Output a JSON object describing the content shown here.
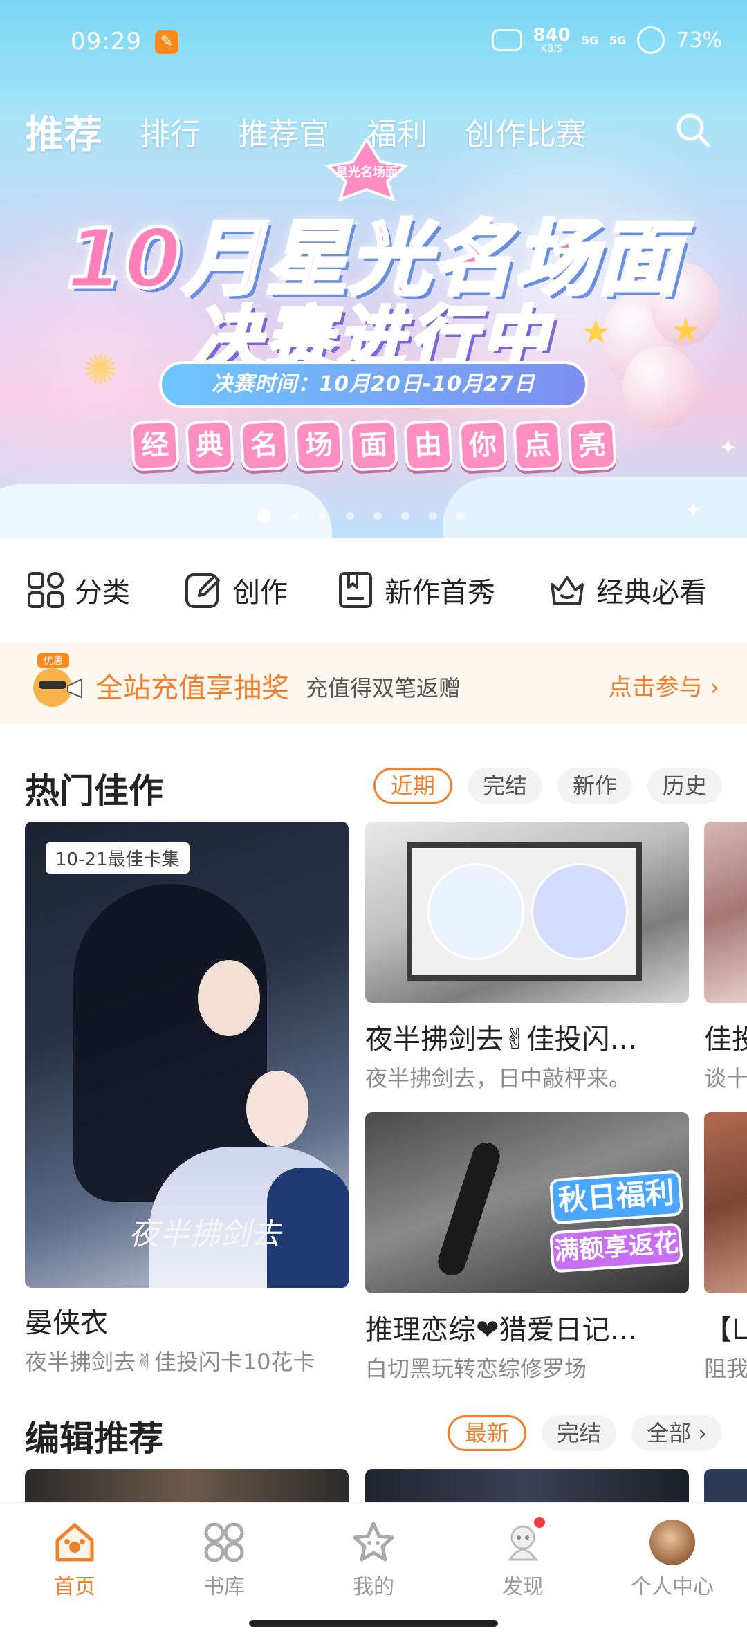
{
  "status_bar": {
    "time": "09:29",
    "net_speed": "840",
    "net_unit": "KB/S",
    "signal1": "5G",
    "signal2": "5G",
    "battery": "73%"
  },
  "top_nav": {
    "tabs": [
      "推荐",
      "排行",
      "推荐官",
      "福利",
      "创作比赛"
    ],
    "active_index": 0
  },
  "banner": {
    "badge": "星光名场面",
    "title": "10月星光名场面",
    "subtitle": "决赛进行中",
    "date": "决赛时间：10月20日-10月27日",
    "tiles": [
      "经",
      "典",
      "名",
      "场",
      "面",
      "由",
      "你",
      "点",
      "亮"
    ],
    "page_count": 8,
    "active_page": 0
  },
  "quick_entries": [
    {
      "label": "分类",
      "icon": "grid-icon"
    },
    {
      "label": "创作",
      "icon": "pencil-icon"
    },
    {
      "label": "新作首秀",
      "icon": "bookmark-icon"
    },
    {
      "label": "经典必看",
      "icon": "crown-icon"
    }
  ],
  "promo": {
    "badge": "优惠",
    "main": "全站充值享抽奖",
    "sub": "充值得双笔返赠",
    "cta": "点击参与 ›"
  },
  "hot": {
    "title": "热门佳作",
    "filters": [
      "近期",
      "完结",
      "新作",
      "历史"
    ],
    "active_filter": 0,
    "big_card": {
      "badge": "10-21最佳卡集",
      "title": "晏侠衣",
      "desc": "夜半拂剑去✌佳投闪卡10花卡",
      "art_text": "夜半拂剑去"
    },
    "cards": [
      {
        "title": "夜半拂剑去✌佳投闪…",
        "desc": "夜半拂剑去，日中敲枰来。"
      },
      {
        "title": "推理恋综❤猎爱日记…",
        "desc": "白切黑玩转恋综修罗场",
        "stamp_top": "秋日福利",
        "stamp_bottom": "满额享返花"
      }
    ],
    "edge_cards": [
      {
        "title": "佳投",
        "desc": "谈十"
      },
      {
        "title": "【L",
        "desc": "阻我"
      }
    ]
  },
  "editor": {
    "title": "编辑推荐",
    "filters": [
      "最新",
      "完结",
      "全部 ›"
    ],
    "active_filter": 0
  },
  "bottom_nav": {
    "items": [
      {
        "label": "首页",
        "icon": "home-icon"
      },
      {
        "label": "书库",
        "icon": "library-icon"
      },
      {
        "label": "我的",
        "icon": "star-icon"
      },
      {
        "label": "发现",
        "icon": "discover-icon"
      },
      {
        "label": "个人中心",
        "icon": "avatar-icon"
      }
    ],
    "active_index": 0
  },
  "colors": {
    "accent": "#f0802c",
    "promo_bg": "#fff7ee",
    "notification_dot": "#f23c3c"
  }
}
